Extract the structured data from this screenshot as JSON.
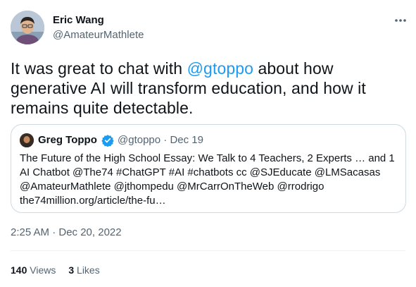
{
  "author": {
    "name": "Eric Wang",
    "handle": "@AmateurMathlete"
  },
  "tweet": {
    "text_before": "It was great to chat with ",
    "mention": "@gtoppo",
    "text_after": " about how generative AI will transform education, and how it remains quite detectable."
  },
  "quote": {
    "name": "Greg Toppo",
    "handle": "@gtoppo",
    "separator": "·",
    "date": "Dec 19",
    "lines": [
      "The Future of the High School Essay: We Talk to 4 Teachers, 2 Experts … and 1",
      "AI Chatbot @The74 #ChatGPT #AI #chatbots cc @SJEducate @LMSacasas",
      "@AmateurMathlete @jthompedu @MrCarrOnTheWeb @rrodrigo",
      "the74million.org/article/the-fu…"
    ]
  },
  "timestamp": "2:25 AM · Dec 20, 2022",
  "stats": {
    "views_count": "140",
    "views_label": "Views",
    "likes_count": "3",
    "likes_label": "Likes"
  },
  "colors": {
    "link": "#1d9bf0",
    "secondary_text": "#536471",
    "border": "#cfd9de",
    "verified": "#1d9bf0"
  },
  "icons": {
    "more": "more-horizontal-icon",
    "verified": "verified-badge-icon"
  }
}
